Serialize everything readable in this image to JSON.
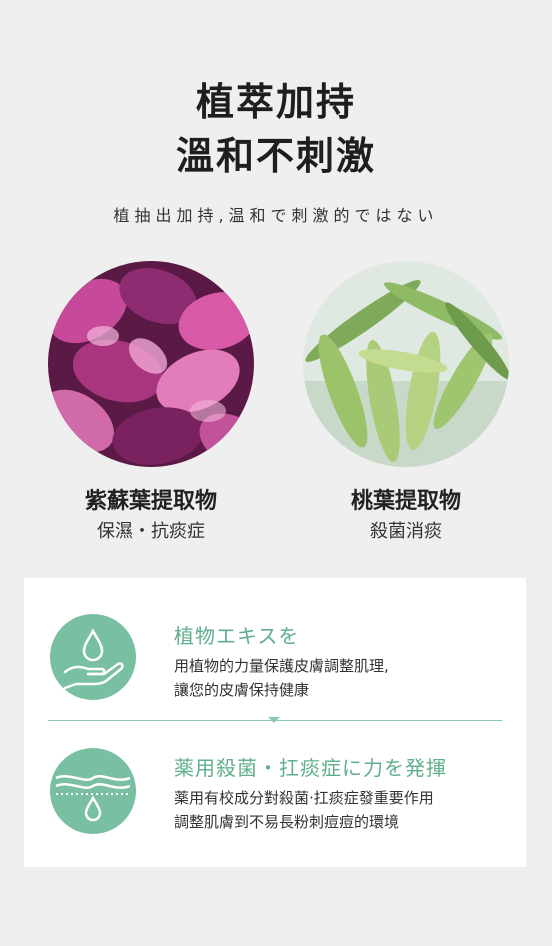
{
  "header": {
    "title_line1": "植萃加持",
    "title_line2": "溫和不刺激",
    "subtitle": "植抽出加持,温和で刺激的ではない"
  },
  "ingredients": [
    {
      "name": "紫蘇葉提取物",
      "desc": "保濕・抗痰症",
      "image": "purple-shiso-leaves-photo"
    },
    {
      "name": "桃葉提取物",
      "desc": "殺菌消痰",
      "image": "peach-leaves-photo"
    }
  ],
  "features": [
    {
      "title": "植物エキスを",
      "lines": [
        "用植物的力量保護皮膚調整肌理,",
        "讓您的皮膚保持健康"
      ],
      "icon": "water-drop-hand-icon"
    },
    {
      "title": "薬用殺菌・扛痰症に力を発揮",
      "lines": [
        "薬用有校成分對殺菌‧扛痰症發重要作用",
        "調整肌膚到不易長粉刺痘痘的環境"
      ],
      "icon": "skin-layer-drop-icon"
    }
  ],
  "colors": {
    "accent": "#5fae8c",
    "icon_bg": "#79bfa2",
    "page_bg": "#efefef"
  }
}
